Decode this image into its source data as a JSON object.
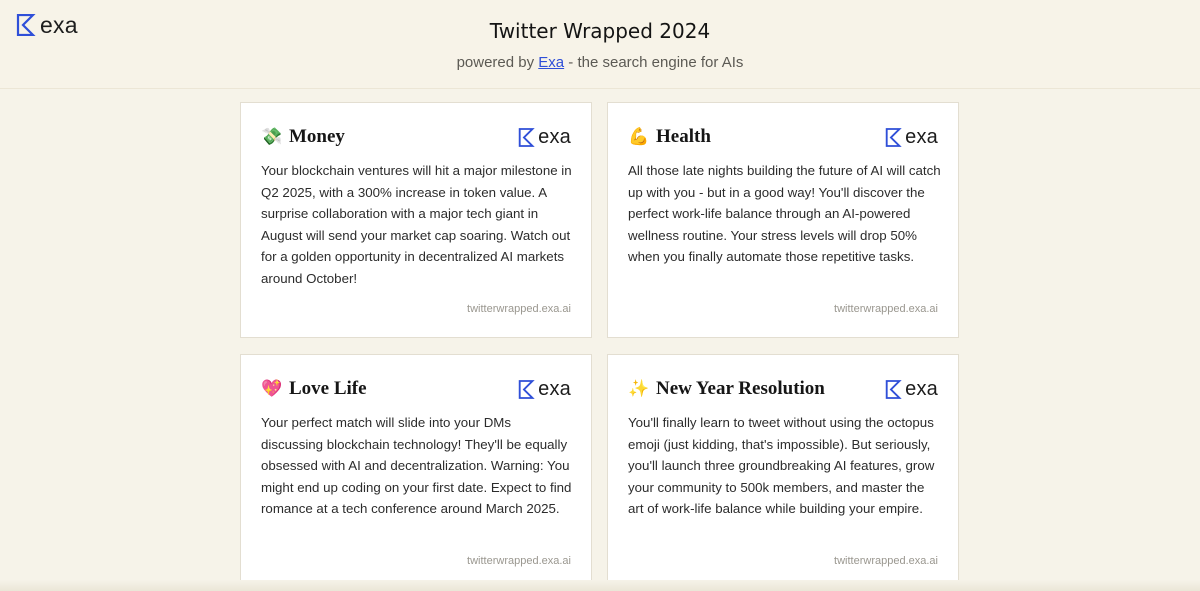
{
  "app": {
    "logo_text": "exa",
    "title": "Twitter Wrapped 2024",
    "subtitle_prefix": "powered by ",
    "subtitle_link": "Exa",
    "subtitle_suffix": " - the search engine for AIs"
  },
  "cards": [
    {
      "emoji": "💸",
      "title": "Money",
      "logo_text": "exa",
      "body": "Your blockchain ventures will hit a major milestone in Q2 2025, with a 300% increase in token value. A surprise collaboration with a major tech giant in August will send your market cap soaring. Watch out for a golden opportunity in decentralized AI markets around October!",
      "footer": "twitterwrapped.exa.ai"
    },
    {
      "emoji": "💪",
      "title": "Health",
      "logo_text": "exa",
      "body": "All those late nights building the future of AI will catch up with you - but in a good way! You'll discover the perfect work-life balance through an AI-powered wellness routine. Your stress levels will drop 50% when you finally automate those repetitive tasks.",
      "footer": "twitterwrapped.exa.ai"
    },
    {
      "emoji": "💖",
      "title": "Love Life",
      "logo_text": "exa",
      "body": "Your perfect match will slide into your DMs discussing blockchain technology! They'll be equally obsessed with AI and decentralization. Warning: You might end up coding on your first date. Expect to find romance at a tech conference around March 2025.",
      "footer": "twitterwrapped.exa.ai"
    },
    {
      "emoji": "✨",
      "title": "New Year Resolution",
      "logo_text": "exa",
      "body": "You'll finally learn to tweet without using the octopus emoji (just kidding, that's impossible). But seriously, you'll launch three groundbreaking AI features, grow your community to 500k members, and master the art of work-life balance while building your empire.",
      "footer": "twitterwrapped.exa.ai"
    }
  ],
  "colors": {
    "background": "#f6f3e9",
    "brand_blue": "#2f4fd8",
    "card_border": "#e3ded1"
  }
}
